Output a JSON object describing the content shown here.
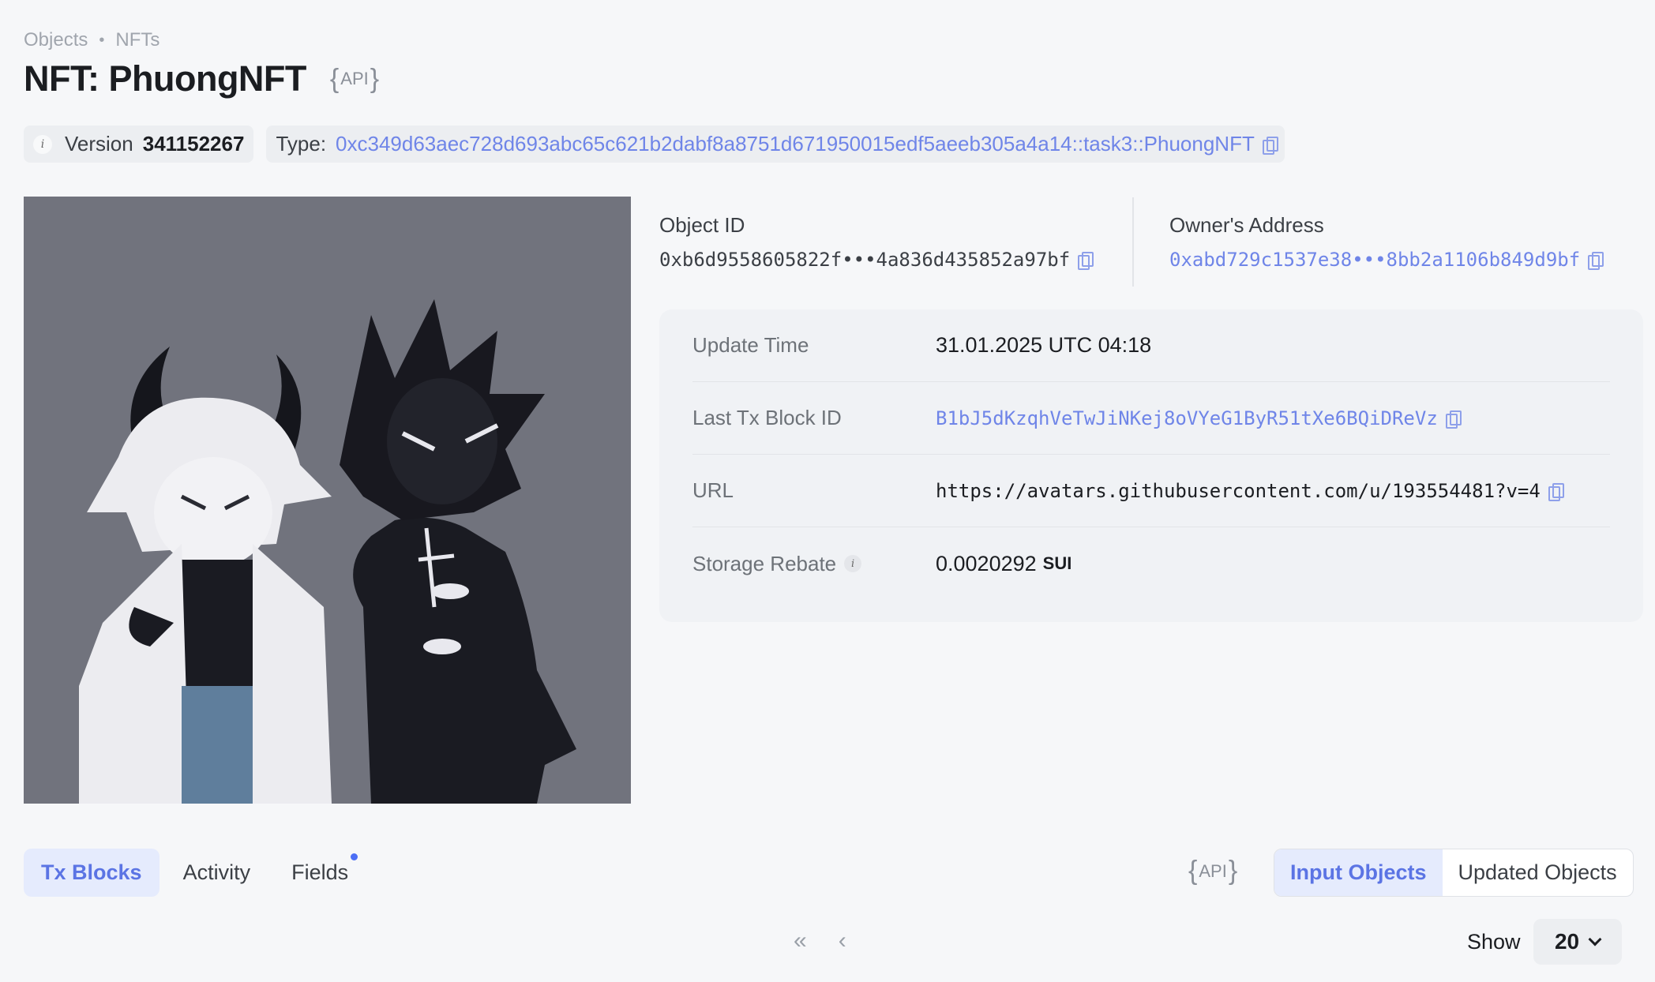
{
  "breadcrumb": {
    "items": [
      "Objects",
      "NFTs"
    ],
    "separator": "•"
  },
  "header": {
    "title": "NFT: PhuongNFT",
    "api_label": "API"
  },
  "meta": {
    "version_label": "Version",
    "version_value": "341152267",
    "type_label": "Type:",
    "type_value": "0xc349d63aec728d693abc65c621b2dabf8a8751d671950015edf5aeeb305a4a14::task3::PhuongNFT"
  },
  "object": {
    "id_label": "Object ID",
    "id_value": "0xb6d9558605822f•••4a836d435852a97bf",
    "owner_label": "Owner's Address",
    "owner_value": "0xabd729c1537e38•••8bb2a1106b849d9bf"
  },
  "details": {
    "update_time_label": "Update Time",
    "update_time_value": "31.01.2025 UTC 04:18",
    "last_tx_label": "Last Tx Block ID",
    "last_tx_value": "B1bJ5dKzqhVeTwJiNKej8oVYeG1ByR51tXe6BQiDReVz",
    "url_label": "URL",
    "url_value": "https://avatars.githubusercontent.com/u/193554481?v=4",
    "rebate_label": "Storage Rebate",
    "rebate_value": "0.0020292",
    "rebate_unit": "SUI"
  },
  "tabs": {
    "items": [
      "Tx Blocks",
      "Activity",
      "Fields"
    ],
    "active": "Tx Blocks"
  },
  "toggle": {
    "api_label": "API",
    "input_objects": "Input Objects",
    "updated_objects": "Updated Objects"
  },
  "pagination": {
    "first": "«",
    "prev": "‹",
    "show_label": "Show",
    "page_size": "20"
  },
  "colors": {
    "accent": "#6f85e8",
    "active_bg": "#e5ebfd",
    "background": "#f6f7f9"
  }
}
